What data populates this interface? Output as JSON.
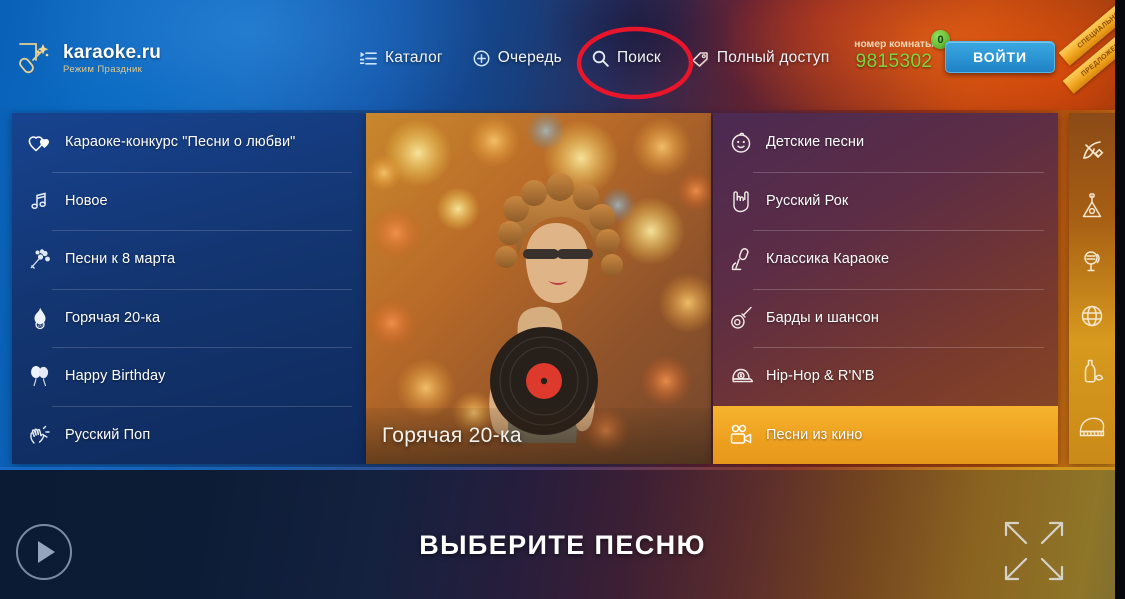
{
  "header": {
    "logo": {
      "brand": "karaoke.ru",
      "subtitle": "Режим Праздник",
      "icon": "microphone-icon"
    },
    "nav": [
      {
        "label": "Каталог",
        "icon": "catalog-icon"
      },
      {
        "label": "Очередь",
        "icon": "queue-plus-icon"
      },
      {
        "label": "Поиск",
        "icon": "search-icon"
      },
      {
        "label": "Полный доступ",
        "icon": "tag-icon"
      }
    ],
    "room": {
      "label": "номер комнаты",
      "number": "9815302",
      "badge": "0"
    },
    "login_label": "ВОЙТИ",
    "ribbon": {
      "line1": "СПЕЦИАЛЬНОЕ",
      "line2": "ПРЕДЛОЖЕНИЕ"
    },
    "annotation": {
      "target": "Поиск",
      "color": "#e8152b",
      "shape": "ellipse"
    }
  },
  "left_menu": [
    {
      "label": "Караоке-конкурс \"Песни о любви\"",
      "icon": "hearts-icon"
    },
    {
      "label": "Новое",
      "icon": "music-note-icon"
    },
    {
      "label": "Песни к 8 марта",
      "icon": "flowers-icon"
    },
    {
      "label": "Горячая 20-ка",
      "icon": "flame-icon"
    },
    {
      "label": "Happy Birthday",
      "icon": "balloons-icon"
    },
    {
      "label": "Русский Поп",
      "icon": "clap-hands-icon"
    }
  ],
  "center_card": {
    "caption": "Горячая 20-ка"
  },
  "right_menu": [
    {
      "label": "Детские песни",
      "icon": "baby-face-icon",
      "active": false
    },
    {
      "label": "Русский Рок",
      "icon": "rock-hand-icon",
      "active": false
    },
    {
      "label": "Классика Караоке",
      "icon": "mic-stand-icon",
      "active": false
    },
    {
      "label": "Барды и шансон",
      "icon": "guitar-icon",
      "active": false
    },
    {
      "label": "Hip-Hop & R'N'B",
      "icon": "cap-icon",
      "active": false
    },
    {
      "label": "Песни из кино",
      "icon": "movie-camera-icon",
      "active": true
    }
  ],
  "icon_strip": [
    {
      "icon": "hammer-sickle-icon"
    },
    {
      "icon": "balalaika-icon"
    },
    {
      "icon": "retro-microphone-icon"
    },
    {
      "icon": "globe-icon"
    },
    {
      "icon": "bottle-icon"
    },
    {
      "icon": "piano-icon"
    }
  ],
  "footer": {
    "title": "ВЫБЕРИТЕ ПЕСНЮ",
    "play_icon": "play-icon",
    "fullscreen_icon": "fullscreen-expand-icon"
  },
  "colors": {
    "accent_blue": "#2e98d6",
    "highlight_amber": "#f0a829",
    "room_green": "#7dd63f",
    "annotation_red": "#e8152b"
  }
}
